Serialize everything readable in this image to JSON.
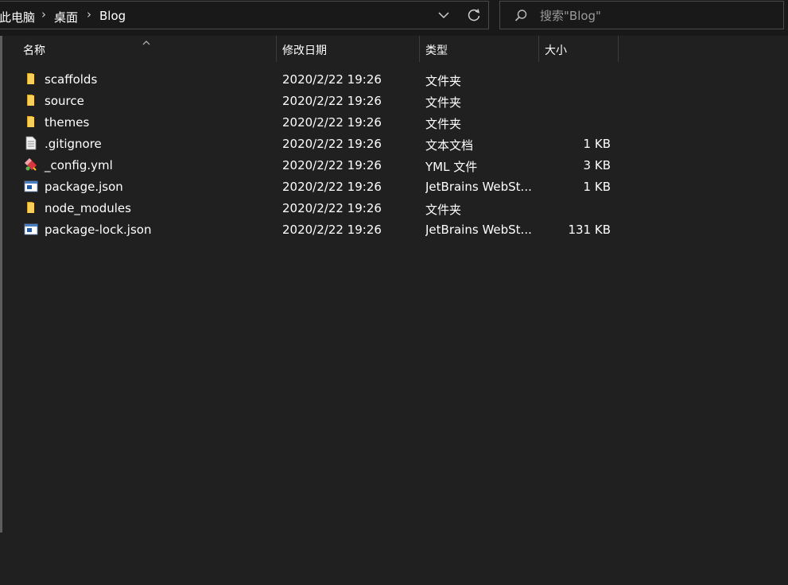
{
  "breadcrumb": {
    "items": [
      "此电脑",
      "桌面",
      "Blog"
    ],
    "separator_icon": "chevron-right-icon"
  },
  "toolbar": {
    "dropdown_icon": "chevron-down-icon",
    "refresh_icon": "refresh-icon"
  },
  "search": {
    "placeholder": "搜索\"Blog\"",
    "icon": "search-icon"
  },
  "columns": {
    "name": "名称",
    "modified": "修改日期",
    "type": "类型",
    "size": "大小",
    "sort_icon": "sort-ascending-icon"
  },
  "files": [
    {
      "name": "scaffolds",
      "modified": "2020/2/22 19:26",
      "type": "文件夹",
      "size": "",
      "icon": "folder-icon"
    },
    {
      "name": "source",
      "modified": "2020/2/22 19:26",
      "type": "文件夹",
      "size": "",
      "icon": "folder-icon"
    },
    {
      "name": "themes",
      "modified": "2020/2/22 19:26",
      "type": "文件夹",
      "size": "",
      "icon": "folder-icon"
    },
    {
      "name": ".gitignore",
      "modified": "2020/2/22 19:26",
      "type": "文本文档",
      "size": "1 KB",
      "icon": "text-file-icon"
    },
    {
      "name": "_config.yml",
      "modified": "2020/2/22 19:26",
      "type": "YML 文件",
      "size": "3 KB",
      "icon": "yml-file-icon"
    },
    {
      "name": "package.json",
      "modified": "2020/2/22 19:26",
      "type": "JetBrains WebSt...",
      "size": "1 KB",
      "icon": "webstorm-file-icon"
    },
    {
      "name": "node_modules",
      "modified": "2020/2/22 19:26",
      "type": "文件夹",
      "size": "",
      "icon": "folder-icon"
    },
    {
      "name": "package-lock.json",
      "modified": "2020/2/22 19:26",
      "type": "JetBrains WebSt...",
      "size": "131 KB",
      "icon": "webstorm-file-icon"
    }
  ],
  "colors": {
    "background": "#202020",
    "folder": "#f4c430",
    "text": "#ffffff"
  }
}
